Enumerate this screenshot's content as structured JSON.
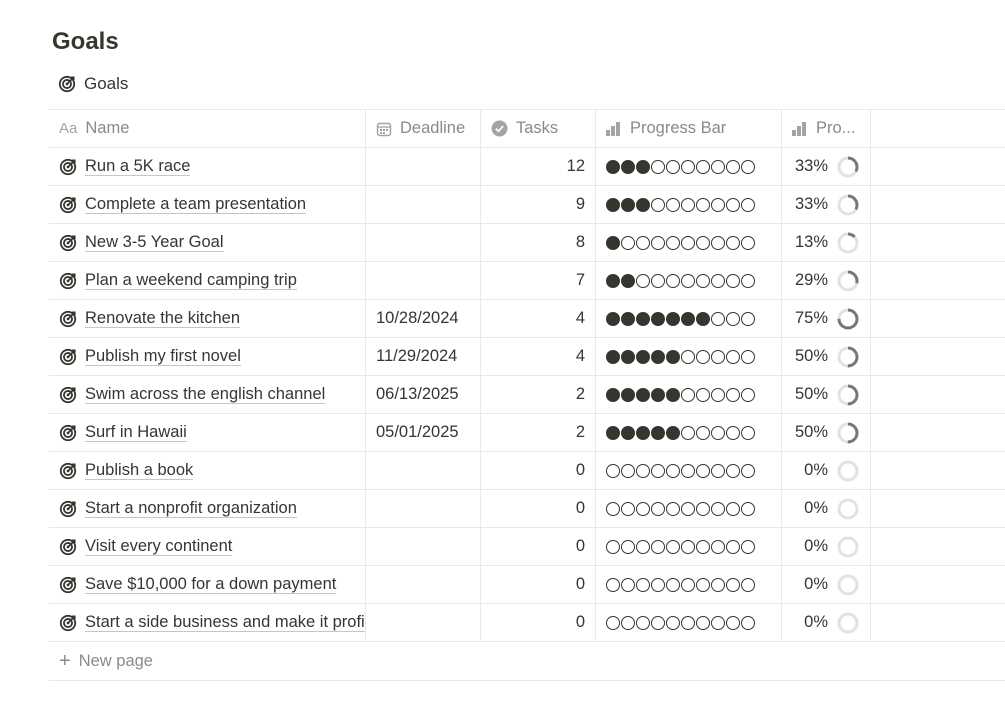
{
  "page": {
    "title": "Goals"
  },
  "view": {
    "tab_label": "Goals"
  },
  "columns": {
    "name": "Name",
    "name_prefix": "Aa",
    "deadline": "Deadline",
    "tasks": "Tasks",
    "progress_bar": "Progress Bar",
    "progress": "Pro..."
  },
  "rows": [
    {
      "name": "Run a 5K race",
      "deadline": "",
      "tasks": "12",
      "progress": 0.33,
      "pct": "33%",
      "dots": 3
    },
    {
      "name": "Complete a team presentation",
      "deadline": "",
      "tasks": "9",
      "progress": 0.33,
      "pct": "33%",
      "dots": 3
    },
    {
      "name": "New 3-5 Year Goal",
      "deadline": "",
      "tasks": "8",
      "progress": 0.13,
      "pct": "13%",
      "dots": 1
    },
    {
      "name": "Plan a weekend camping trip",
      "deadline": "",
      "tasks": "7",
      "progress": 0.29,
      "pct": "29%",
      "dots": 2
    },
    {
      "name": "Renovate the kitchen",
      "deadline": "10/28/2024",
      "tasks": "4",
      "progress": 0.75,
      "pct": "75%",
      "dots": 7
    },
    {
      "name": "Publish my first novel",
      "deadline": "11/29/2024",
      "tasks": "4",
      "progress": 0.5,
      "pct": "50%",
      "dots": 5
    },
    {
      "name": "Swim across the english channel",
      "deadline": "06/13/2025",
      "tasks": "2",
      "progress": 0.5,
      "pct": "50%",
      "dots": 5
    },
    {
      "name": "Surf in Hawaii",
      "deadline": "05/01/2025",
      "tasks": "2",
      "progress": 0.5,
      "pct": "50%",
      "dots": 5
    },
    {
      "name": "Publish a book",
      "deadline": "",
      "tasks": "0",
      "progress": 0,
      "pct": "0%",
      "dots": 0
    },
    {
      "name": "Start a nonprofit organization",
      "deadline": "",
      "tasks": "0",
      "progress": 0,
      "pct": "0%",
      "dots": 0
    },
    {
      "name": "Visit every continent",
      "deadline": "",
      "tasks": "0",
      "progress": 0,
      "pct": "0%",
      "dots": 0
    },
    {
      "name": "Save $10,000 for a down payment",
      "deadline": "",
      "tasks": "0",
      "progress": 0,
      "pct": "0%",
      "dots": 0
    },
    {
      "name": "Start a side business and make it profitable",
      "deadline": "",
      "tasks": "0",
      "progress": 0,
      "pct": "0%",
      "dots": 0
    }
  ],
  "progress_bar_total_dots": 10,
  "new_row": {
    "label": "New page"
  },
  "colors": {
    "text": "#37352f",
    "muted": "#8b8a86",
    "grid": "#e9e9e7",
    "ring_track": "#e3e2e0",
    "ring_fill": "#787774"
  },
  "icons": {
    "goal": "target-icon",
    "deadline": "calendar-icon",
    "tasks": "checkmark-circle-icon",
    "progress": "bar-chart-icon",
    "add": "plus-icon"
  }
}
